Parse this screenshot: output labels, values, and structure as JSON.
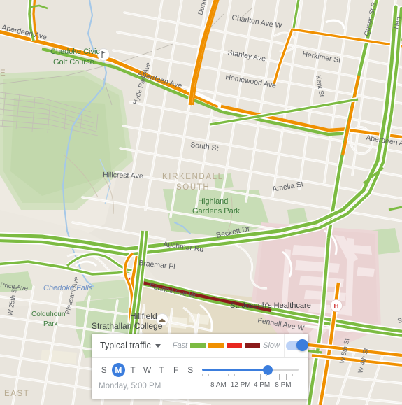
{
  "app": {
    "type": "map",
    "theme": "google-maps-traffic"
  },
  "map": {
    "streets": [
      {
        "name": "Aberdeen Ave",
        "id": "aberdeen-ave-west"
      },
      {
        "name": "Aberdeen Ave",
        "id": "aberdeen-ave-mid"
      },
      {
        "name": "Aberdeen A",
        "id": "aberdeen-ave-east"
      },
      {
        "name": "Charlton Ave W",
        "id": "charlton-ave-w"
      },
      {
        "name": "Stanley Ave",
        "id": "stanley-ave"
      },
      {
        "name": "Homewood Ave",
        "id": "homewood-ave"
      },
      {
        "name": "Herkimer St",
        "id": "herkimer-st"
      },
      {
        "name": "Kent St",
        "id": "kent-st"
      },
      {
        "name": "Dundurn St S",
        "id": "dundurn-st-s"
      },
      {
        "name": "Queen St S",
        "id": "queen-st-s"
      },
      {
        "name": "Hyde Park Ave",
        "id": "hyde-park-ave"
      },
      {
        "name": "South St",
        "id": "south-st"
      },
      {
        "name": "Hillcrest Ave",
        "id": "hillcrest-ave"
      },
      {
        "name": "Amelia St",
        "id": "amelia-st"
      },
      {
        "name": "Beckett Dr",
        "id": "beckett-dr"
      },
      {
        "name": "Auchmar Rd",
        "id": "auchmar-rd"
      },
      {
        "name": "Braemar Pl",
        "id": "braemar-pl"
      },
      {
        "name": "Fennell Ave W",
        "id": "fennell-ave-w-1"
      },
      {
        "name": "Fennell Ave W",
        "id": "fennell-ave-w-2"
      },
      {
        "name": "Price Ave",
        "id": "price-ave"
      },
      {
        "name": "Pleasant Ave",
        "id": "pleasant-ave"
      },
      {
        "name": "W 25th St",
        "id": "w-25th-st"
      },
      {
        "name": "W 5th St",
        "id": "w-5th-st"
      },
      {
        "name": "W 4th St",
        "id": "w-4th-st"
      },
      {
        "name": "Hen",
        "id": "herkimer-edge"
      },
      {
        "name": "St",
        "id": "st-edge"
      },
      {
        "name": "Pri",
        "id": "price-edge"
      }
    ],
    "places": [
      {
        "name": "Chedoke Civic",
        "id": "chedoke-civic-golf-course-l1",
        "kind": "golf"
      },
      {
        "name": "Golf Course",
        "id": "chedoke-civic-golf-course-l2",
        "kind": "golf"
      },
      {
        "name": "Highland",
        "id": "highland-gardens-park-l1",
        "kind": "park"
      },
      {
        "name": "Gardens Park",
        "id": "highland-gardens-park-l2",
        "kind": "park"
      },
      {
        "name": "Colquhoun",
        "id": "colquhoun-park-l1",
        "kind": "park"
      },
      {
        "name": "Park",
        "id": "colquhoun-park-l2",
        "kind": "park"
      },
      {
        "name": "Chedoke Falls",
        "id": "chedoke-falls",
        "kind": "water"
      },
      {
        "name": "Hillfield",
        "id": "hillfield-strathallan-college-l1",
        "kind": "school"
      },
      {
        "name": "Strathallan College",
        "id": "hillfield-strathallan-college-l2",
        "kind": "school"
      },
      {
        "name": "St. Joseph's Healthcare",
        "id": "st-josephs-healthcare",
        "kind": "hospital"
      },
      {
        "name": "H",
        "id": "hospital-marker-letter",
        "kind": "hospital-icon"
      }
    ],
    "neighborhoods": [
      {
        "name": "KIRKENDALL",
        "id": "kirkendall-south-l1"
      },
      {
        "name": "SOUTH",
        "id": "kirkendall-south-l2"
      },
      {
        "name": "EAST",
        "id": "east-neighborhood"
      },
      {
        "name": "E",
        "id": "west-edge-neighborhood"
      }
    ],
    "colors": {
      "land": "#e9e5dd",
      "park": "#c8ddb6",
      "golf": "#cfe0bd",
      "school": "#e4dcc6",
      "hospital": "#ecd6d6",
      "road_fill": "#ffffff",
      "road_minor": "#f4f2ee",
      "water": "#a5c8e8",
      "traffic_fast": "#7cbb42",
      "traffic_moderate": "#f09000",
      "traffic_slow": "#e8271f",
      "traffic_very_slow": "#8b1a1a"
    }
  },
  "traffic_panel": {
    "select_label": "Typical traffic",
    "legend": {
      "fast_label": "Fast",
      "slow_label": "Slow",
      "swatches": [
        "#7cbb42",
        "#f09000",
        "#e8271f",
        "#8b1a1a"
      ]
    },
    "toggle": {
      "state": "on",
      "on_color": "#3b7ddd",
      "track_color": "#bcd2f7"
    },
    "days": [
      {
        "letter": "S",
        "full": "Sunday",
        "selected": false
      },
      {
        "letter": "M",
        "full": "Monday",
        "selected": true
      },
      {
        "letter": "T",
        "full": "Tuesday",
        "selected": false
      },
      {
        "letter": "W",
        "full": "Wednesday",
        "selected": false
      },
      {
        "letter": "T",
        "full": "Thursday",
        "selected": false
      },
      {
        "letter": "F",
        "full": "Friday",
        "selected": false
      },
      {
        "letter": "S",
        "full": "Saturday",
        "selected": false
      }
    ],
    "selected_datetime": "Monday, 5:00 PM",
    "slider": {
      "value_percent": 68,
      "tick_labels": [
        "8 AM",
        "12 PM",
        "4 PM",
        "8 PM"
      ],
      "tick_positions": [
        17,
        40,
        62,
        84
      ]
    }
  }
}
